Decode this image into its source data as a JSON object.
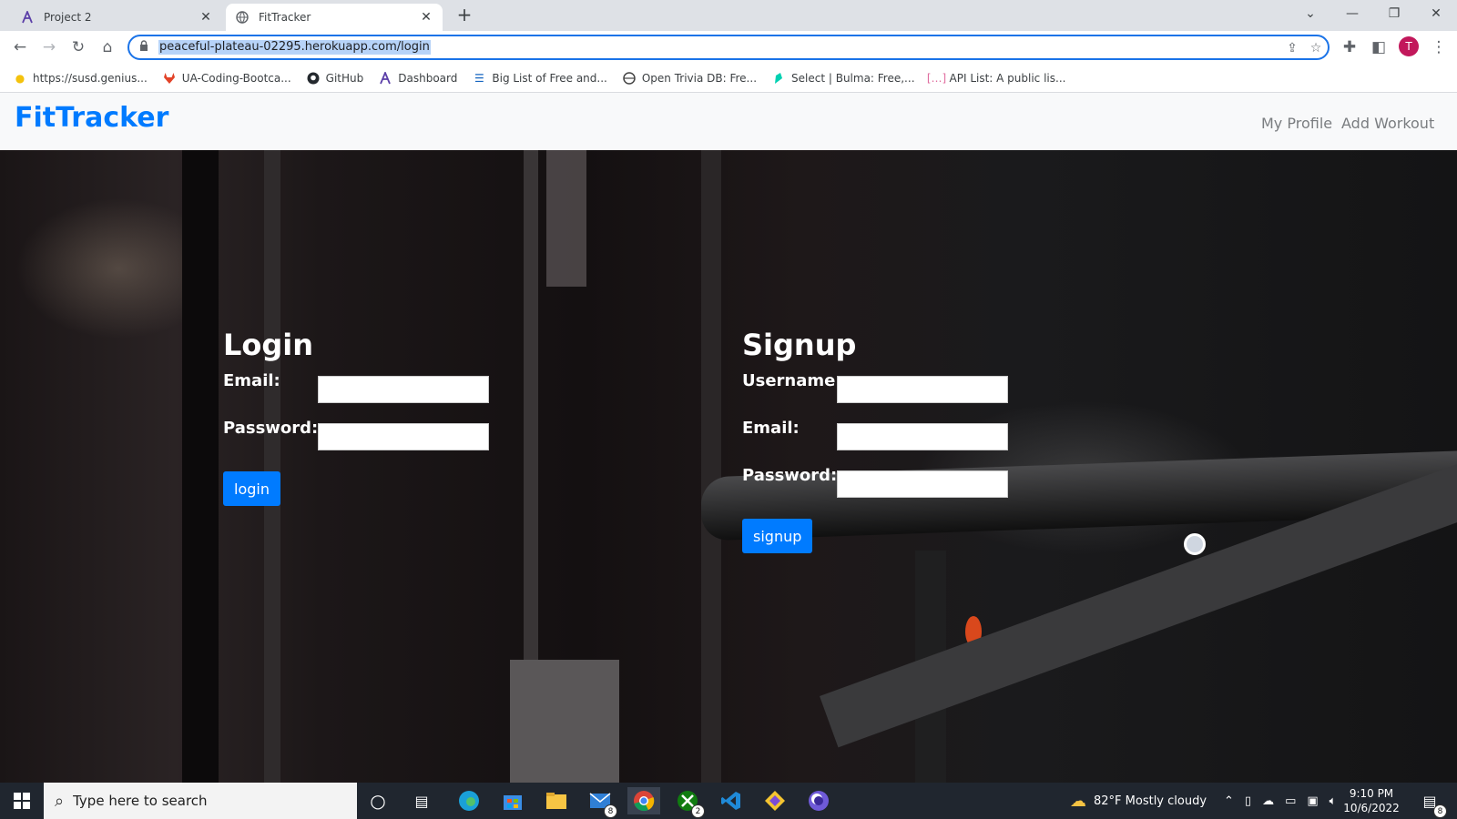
{
  "browser": {
    "tabs": [
      {
        "label": "Project 2",
        "active": false
      },
      {
        "label": "FitTracker",
        "active": true
      }
    ],
    "url": "peaceful-plateau-02295.herokuapp.com/login",
    "profile_initial": "T",
    "bookmarks": [
      {
        "label": "https://susd.genius...",
        "icon": "lightbulb-icon"
      },
      {
        "label": "UA-Coding-Bootca...",
        "icon": "gitlab-icon"
      },
      {
        "label": "GitHub",
        "icon": "github-icon"
      },
      {
        "label": "Dashboard",
        "icon": "dashboard-icon"
      },
      {
        "label": "Big List of Free and...",
        "icon": "list-icon"
      },
      {
        "label": "Open Trivia DB: Fre...",
        "icon": "globe-icon"
      },
      {
        "label": "Select | Bulma: Free,...",
        "icon": "bulma-icon"
      },
      {
        "label": "API List: A public lis...",
        "icon": "brackets-icon"
      }
    ]
  },
  "site": {
    "brand": "FitTracker",
    "nav": {
      "profile": "My Profile",
      "add_workout": "Add Workout"
    }
  },
  "login": {
    "title": "Login",
    "email_label": "Email:",
    "password_label": "Password:",
    "email_value": "",
    "password_value": "",
    "button": "login"
  },
  "signup": {
    "title": "Signup",
    "username_label": "Username:",
    "email_label": "Email:",
    "password_label": "Password:",
    "username_value": "",
    "email_value": "",
    "password_value": "",
    "button": "signup"
  },
  "taskbar": {
    "search_placeholder": "Type here to search",
    "weather": "82°F  Mostly cloudy",
    "time": "9:10 PM",
    "date": "10/6/2022",
    "mail_badge": "8",
    "xbox_badge": "2",
    "notifications_badge": "8"
  },
  "colors": {
    "brand": "#007bff",
    "button": "#007bff",
    "navbar_bg": "#f8f9fa",
    "taskbar_bg": "#20262f"
  }
}
